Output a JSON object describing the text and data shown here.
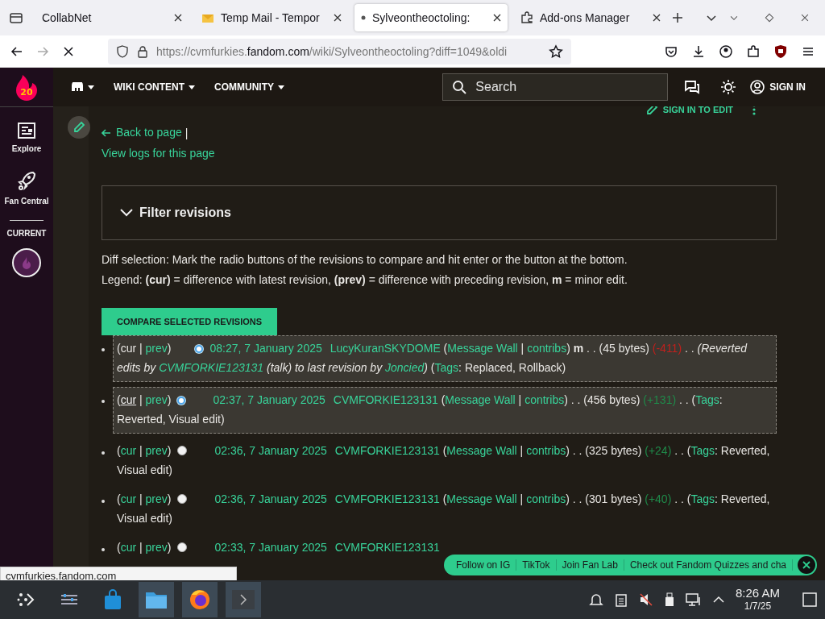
{
  "browser": {
    "tabs": [
      {
        "title": "CollabNet",
        "kind": "plain",
        "selected": false
      },
      {
        "title": "Temp Mail - Tempor",
        "kind": "mail",
        "selected": false
      },
      {
        "title": "Sylveontheoctoling:",
        "kind": "dot",
        "selected": true
      },
      {
        "title": "Add-ons Manager",
        "kind": "addon",
        "selected": false
      }
    ],
    "url_host_prefix": "https://cvmfurkies.",
    "url_host": "fandom.com",
    "url_path": "/wiki/Sylveontheoctoling?diff=1049&oldi"
  },
  "fandom_header": {
    "badge": "20",
    "nav": [
      "WIKI CONTENT",
      "COMMUNITY"
    ],
    "search": {
      "placeholder": "Search"
    },
    "sign_in": "SIGN IN"
  },
  "sidebar": {
    "items": [
      "Explore",
      "Fan Central"
    ],
    "section": "CURRENT"
  },
  "page": {
    "sign_in_to_edit": "SIGN IN TO EDIT",
    "back_link": "Back to page",
    "separator": "|",
    "logs_link": "View logs for this page",
    "filter": {
      "label": "Filter revisions",
      "expanded": false
    },
    "help": "Diff selection: Mark the radio buttons of the revisions to compare and hit enter or the button at the bottom.",
    "legend": "Legend: **(cur)** = difference with latest revision, **(prev)** = difference with preceding revision, **m** = minor edit.",
    "compare_button": "COMPARE SELECTED REVISIONS",
    "revisions": [
      {
        "highlighted": true,
        "segments": [
          {
            "kind": "text",
            "text": "(cur | "
          },
          {
            "kind": "link",
            "text": "prev"
          },
          {
            "kind": "text",
            "text": ")"
          },
          {
            "kind": "new-radio",
            "selected": true
          },
          {
            "kind": "date",
            "text": "08:27, 7 January 2025"
          },
          {
            "kind": "user",
            "text": "LucyKuranSKYDOME"
          },
          {
            "kind": "text",
            "text": " ("
          },
          {
            "kind": "link",
            "text": "Message Wall"
          },
          {
            "kind": "text",
            "text": " | "
          },
          {
            "kind": "link",
            "text": "contribs"
          },
          {
            "kind": "text",
            "text": ") "
          },
          {
            "kind": "minor",
            "text": "m"
          },
          {
            "kind": "text",
            "text": " . . (45 bytes) "
          },
          {
            "kind": "diff-neg",
            "text": "(-411)"
          },
          {
            "kind": "text",
            "text": " . . "
          },
          {
            "kind": "italic",
            "text": "(Reverted edits by "
          },
          {
            "kind": "italic-link",
            "text": "CVMFORKIE123131"
          },
          {
            "kind": "italic",
            "text": " (talk) to last revision by "
          },
          {
            "kind": "italic-link",
            "text": "Joncied"
          },
          {
            "kind": "italic",
            "text": ")"
          },
          {
            "kind": "text",
            "text": " ("
          },
          {
            "kind": "link",
            "text": "Tags"
          },
          {
            "kind": "text",
            "text": ": Replaced, Rollback)"
          }
        ]
      },
      {
        "highlighted": true,
        "segments": [
          {
            "kind": "text",
            "text": "("
          },
          {
            "kind": "hover-link",
            "text": "cur"
          },
          {
            "kind": "text",
            "text": " | "
          },
          {
            "kind": "link",
            "text": "prev"
          },
          {
            "kind": "text",
            "text": ")"
          },
          {
            "kind": "old-radio",
            "selected": true
          },
          {
            "kind": "date",
            "text": "02:37, 7 January 2025"
          },
          {
            "kind": "user",
            "text": "CVMFORKIE123131"
          },
          {
            "kind": "text",
            "text": " ("
          },
          {
            "kind": "link",
            "text": "Message Wall"
          },
          {
            "kind": "text",
            "text": " | "
          },
          {
            "kind": "link",
            "text": "contribs"
          },
          {
            "kind": "text",
            "text": ") . . (456 bytes) "
          },
          {
            "kind": "diff-pos",
            "text": "(+131)"
          },
          {
            "kind": "text",
            "text": " . . ("
          },
          {
            "kind": "link",
            "text": "Tags"
          },
          {
            "kind": "text",
            "text": ": Reverted, Visual edit)"
          }
        ]
      },
      {
        "highlighted": false,
        "segments": [
          {
            "kind": "text",
            "text": "("
          },
          {
            "kind": "link",
            "text": "cur"
          },
          {
            "kind": "text",
            "text": " | "
          },
          {
            "kind": "link",
            "text": "prev"
          },
          {
            "kind": "text",
            "text": ")"
          },
          {
            "kind": "old-radio",
            "selected": false
          },
          {
            "kind": "date",
            "text": "02:36, 7 January 2025"
          },
          {
            "kind": "user",
            "text": "CVMFORKIE123131"
          },
          {
            "kind": "text",
            "text": " ("
          },
          {
            "kind": "link",
            "text": "Message Wall"
          },
          {
            "kind": "text",
            "text": " | "
          },
          {
            "kind": "link",
            "text": "contribs"
          },
          {
            "kind": "text",
            "text": ") . . (325 bytes) "
          },
          {
            "kind": "diff-pos",
            "text": "(+24)"
          },
          {
            "kind": "text",
            "text": " . . ("
          },
          {
            "kind": "link",
            "text": "Tags"
          },
          {
            "kind": "text",
            "text": ": Reverted, Visual edit)"
          }
        ]
      },
      {
        "highlighted": false,
        "segments": [
          {
            "kind": "text",
            "text": "("
          },
          {
            "kind": "link",
            "text": "cur"
          },
          {
            "kind": "text",
            "text": " | "
          },
          {
            "kind": "link",
            "text": "prev"
          },
          {
            "kind": "text",
            "text": ")"
          },
          {
            "kind": "old-radio",
            "selected": false
          },
          {
            "kind": "date",
            "text": "02:36, 7 January 2025"
          },
          {
            "kind": "user",
            "text": "CVMFORKIE123131"
          },
          {
            "kind": "text",
            "text": " ("
          },
          {
            "kind": "link",
            "text": "Message Wall"
          },
          {
            "kind": "text",
            "text": " | "
          },
          {
            "kind": "link",
            "text": "contribs"
          },
          {
            "kind": "text",
            "text": ") . . (301 bytes) "
          },
          {
            "kind": "diff-pos",
            "text": "(+40)"
          },
          {
            "kind": "text",
            "text": " . . ("
          },
          {
            "kind": "link",
            "text": "Tags"
          },
          {
            "kind": "text",
            "text": ": Reverted, Visual edit)"
          }
        ]
      },
      {
        "highlighted": false,
        "segments": [
          {
            "kind": "text",
            "text": "("
          },
          {
            "kind": "link",
            "text": "cur"
          },
          {
            "kind": "text",
            "text": " | "
          },
          {
            "kind": "link",
            "text": "prev"
          },
          {
            "kind": "text",
            "text": ")"
          },
          {
            "kind": "old-radio",
            "selected": false
          },
          {
            "kind": "date",
            "text": "02:33, 7 January 2025"
          },
          {
            "kind": "user",
            "text": "CVMFORKIE123131"
          }
        ]
      }
    ]
  },
  "status_url": "cvmfurkies.fandom.com",
  "social_bar": {
    "items": [
      "Follow on IG",
      "TikTok",
      "Join Fan Lab",
      "Check out Fandom Quizzes and cha"
    ]
  },
  "taskbar": {
    "time": "8:26 AM",
    "date": "1/7/25"
  }
}
